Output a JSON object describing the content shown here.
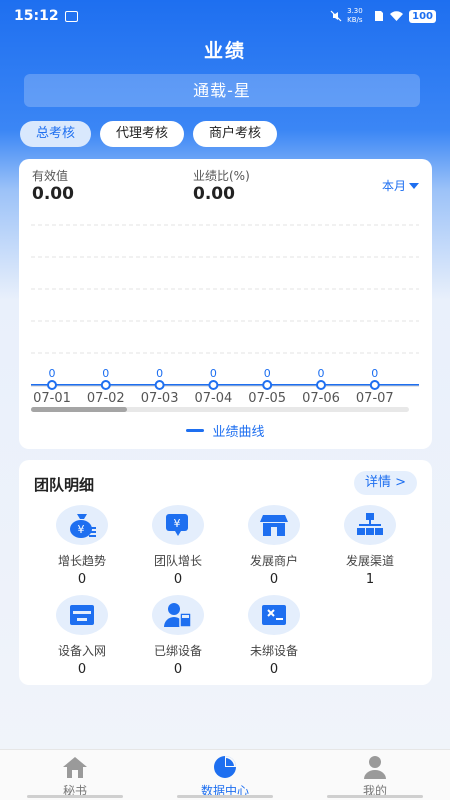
{
  "status_bar": {
    "time": "15:12",
    "network_speed": "3.30 KB/s",
    "battery": "100"
  },
  "page": {
    "title": "业绩",
    "org_name": "通载-星"
  },
  "tabs": [
    {
      "label": "总考核",
      "active": true
    },
    {
      "label": "代理考核",
      "active": false
    },
    {
      "label": "商户考核",
      "active": false
    }
  ],
  "summary": {
    "effective_label": "有效值",
    "effective_value": "0.00",
    "ratio_label": "业绩比(%)",
    "ratio_value": "0.00",
    "period": "本月"
  },
  "chart_data": {
    "type": "line",
    "x": [
      "07-01",
      "07-02",
      "07-03",
      "07-04",
      "07-05",
      "07-06",
      "07-07"
    ],
    "series": [
      {
        "name": "业绩曲线",
        "values": [
          0,
          0,
          0,
          0,
          0,
          0,
          0
        ],
        "data_labels": [
          "0",
          "0",
          "0",
          "0",
          "0",
          "0",
          "0"
        ],
        "color": "#1e6ff0"
      }
    ],
    "legend_position": "bottom-center",
    "grid": true,
    "ylim": [
      0,
      5
    ]
  },
  "team": {
    "title": "团队明细",
    "detail_label": "详情 >",
    "items": [
      {
        "label": "增长趋势",
        "value": "0",
        "icon": "money-bag-icon"
      },
      {
        "label": "团队增长",
        "value": "0",
        "icon": "yen-card-icon"
      },
      {
        "label": "发展商户",
        "value": "0",
        "icon": "storefront-icon"
      },
      {
        "label": "发展渠道",
        "value": "1",
        "icon": "org-chart-icon"
      },
      {
        "label": "设备入网",
        "value": "0",
        "icon": "device-box-icon"
      },
      {
        "label": "已绑设备",
        "value": "0",
        "icon": "user-device-icon"
      },
      {
        "label": "未绑设备",
        "value": "0",
        "icon": "unbound-device-icon"
      }
    ]
  },
  "nav": [
    {
      "label": "秘书",
      "icon": "home-icon",
      "active": false
    },
    {
      "label": "数据中心",
      "icon": "pie-chart-icon",
      "active": true
    },
    {
      "label": "我的",
      "icon": "user-icon",
      "active": false
    }
  ],
  "colors": {
    "primary": "#1e6ff0",
    "light_blue": "#e4eefc"
  }
}
